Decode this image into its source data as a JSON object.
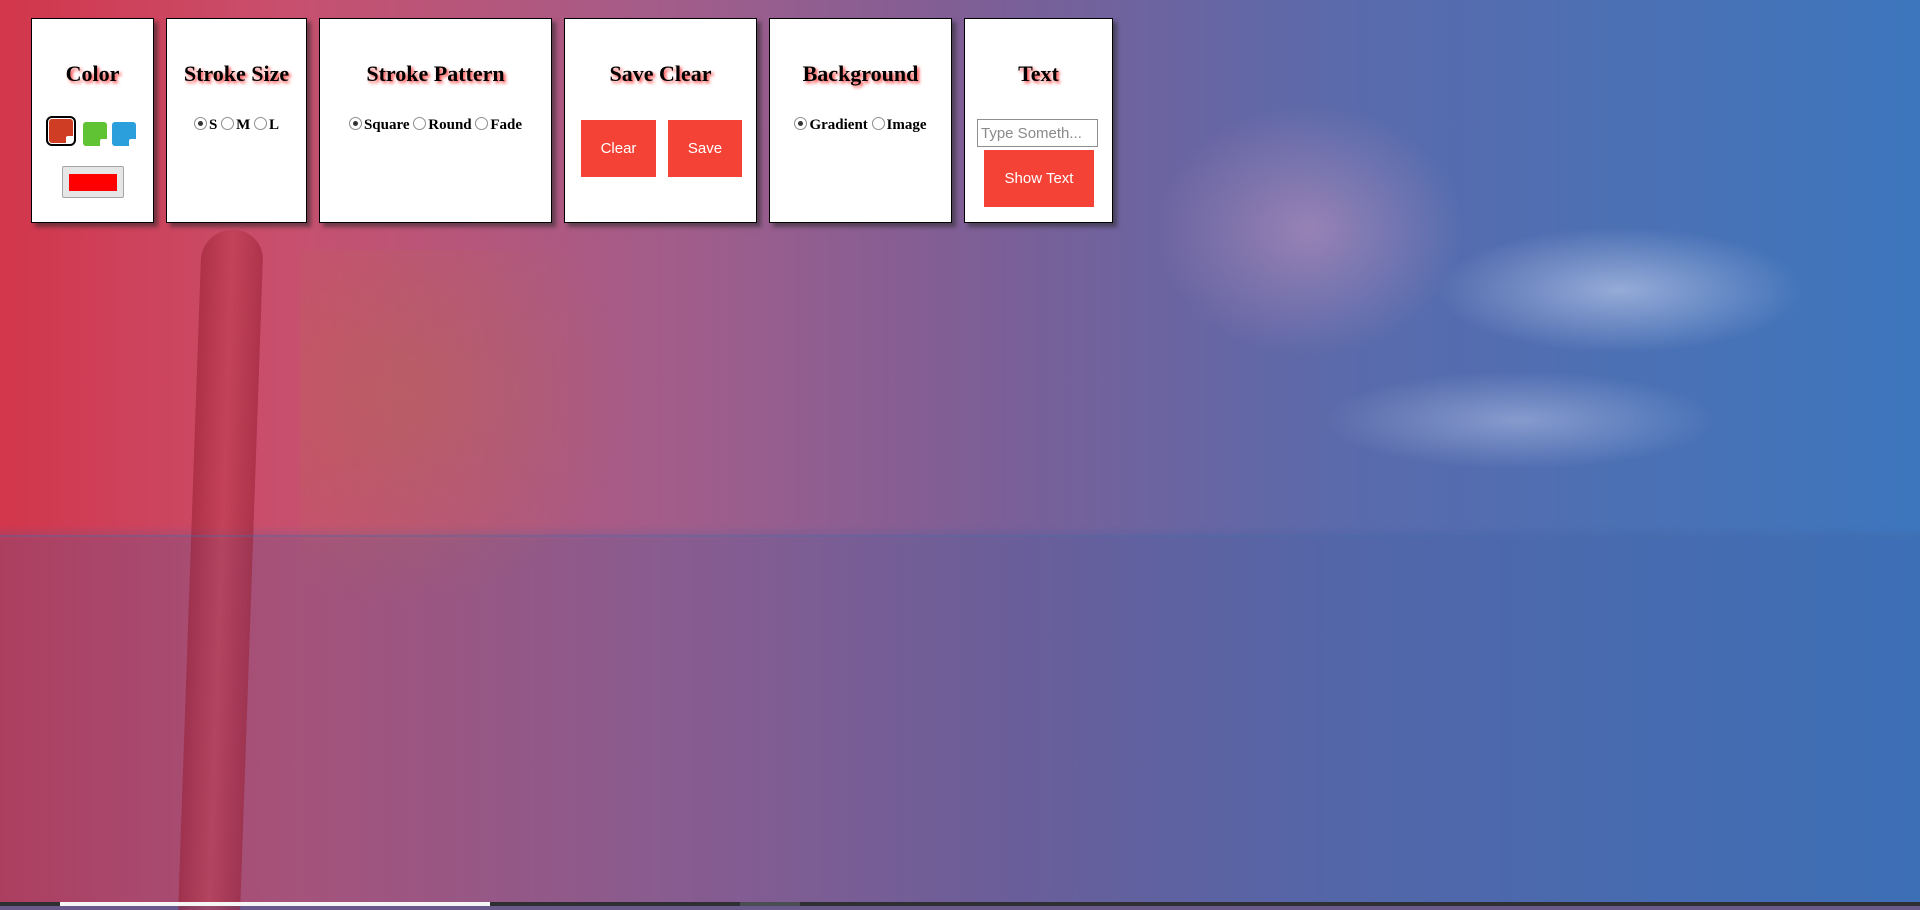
{
  "panels": {
    "color": {
      "title": "Color",
      "swatches": [
        "#cf3d25",
        "#5fc333",
        "#2a9fdc"
      ],
      "selected_color": "#ff0000"
    },
    "stroke_size": {
      "title": "Stroke Size",
      "options": [
        "S",
        "M",
        "L"
      ],
      "selected": "S"
    },
    "stroke_pattern": {
      "title": "Stroke Pattern",
      "options": [
        "Square",
        "Round",
        "Fade"
      ],
      "selected": "Square"
    },
    "save_clear": {
      "title": "Save Clear",
      "clear_label": "Clear",
      "save_label": "Save"
    },
    "background": {
      "title": "Background",
      "options": [
        "Gradient",
        "Image"
      ],
      "selected": "Gradient"
    },
    "text": {
      "title": "Text",
      "placeholder": "Type Someth...",
      "value": "",
      "show_label": "Show Text"
    }
  },
  "colors": {
    "accent_button": "#f44336",
    "title_shadow": "#ff3b3b"
  }
}
